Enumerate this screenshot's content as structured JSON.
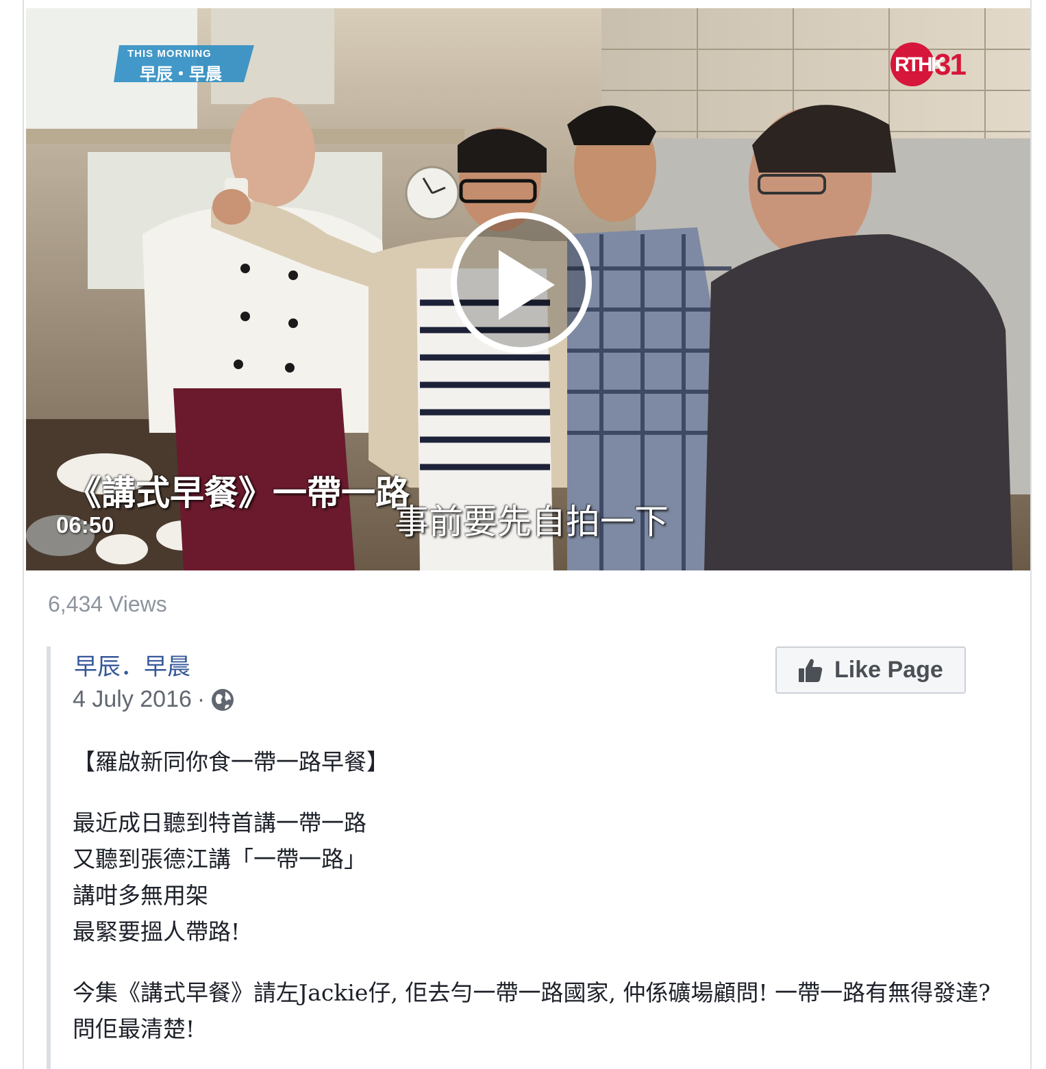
{
  "video": {
    "logo_left_en": "THIS MORNING",
    "logo_left_zh": "早辰・早晨",
    "logo_right_mark": "RTHK",
    "logo_right_num": "31",
    "caption_title": "《講式早餐》一帶一路",
    "caption_subtitle": "事前要先自拍一下",
    "duration": "06:50",
    "play_icon": "play-icon"
  },
  "stats": {
    "views": "6,434 Views"
  },
  "post": {
    "page_name": "早辰．早晨",
    "date": "4 July 2016",
    "separator": "·",
    "audience_icon": "globe-icon",
    "like_button_label": "Like Page",
    "like_icon": "thumbs-up-icon",
    "paragraphs": [
      "【羅啟新同你食一帶一路早餐】",
      "最近成日聽到特首講一帶一路\n又聽到張德江講「一帶一路」\n講咁多無用架\n最緊要搵人帶路!",
      "今集《講式早餐》請左Jackie仔, 佢去勻一帶一路國家, 仲係礦場顧問! 一帶一路有無得發達? 問佢最清楚!"
    ]
  },
  "colors": {
    "link": "#365899",
    "meta": "#616770",
    "views": "#8d949e",
    "rthk_red": "#d6163a"
  }
}
